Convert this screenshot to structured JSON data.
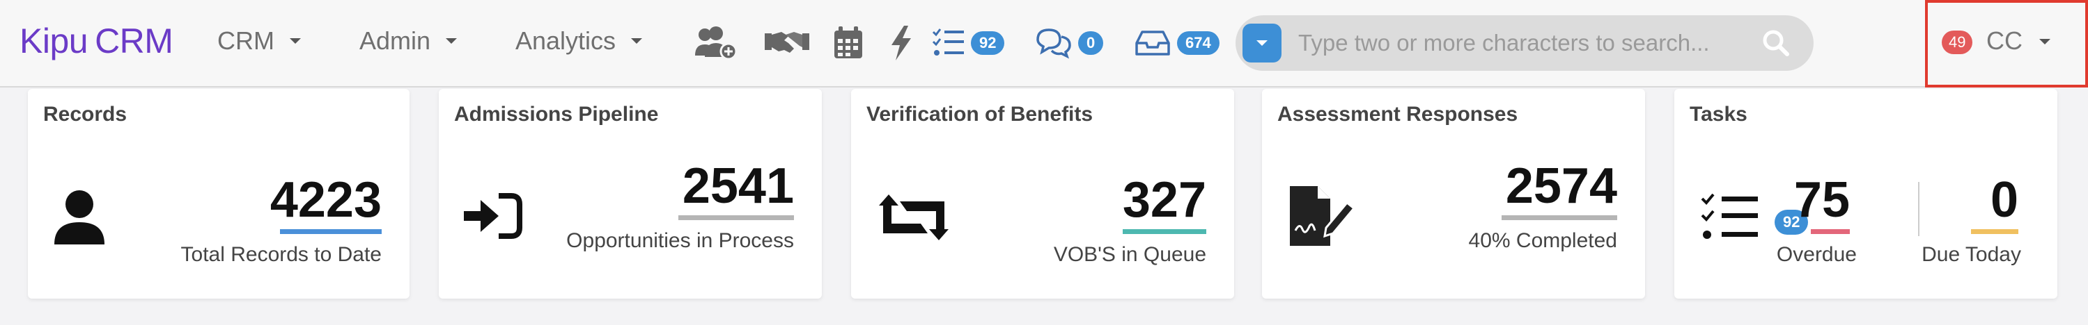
{
  "brand": {
    "part1": "Kipu",
    "part2": "CRM"
  },
  "nav": {
    "crm": "CRM",
    "admin": "Admin",
    "analytics": "Analytics"
  },
  "icons": {
    "tasks_count": "92",
    "messages_count": "0",
    "inbox_count": "674"
  },
  "search": {
    "placeholder": "Type two or more characters to search..."
  },
  "user": {
    "notification_count": "49",
    "initials": "CC"
  },
  "cards": {
    "records": {
      "title": "Records",
      "value": "4223",
      "label": "Total Records to Date",
      "bar_color": "#4a90d9"
    },
    "admissions": {
      "title": "Admissions Pipeline",
      "value": "2541",
      "label": "Opportunities in Process",
      "bar_color": "#b5b5b5"
    },
    "vob": {
      "title": "Verification of Benefits",
      "value": "327",
      "label": "VOB'S in Queue",
      "bar_color": "#4db8b0"
    },
    "assessment": {
      "title": "Assessment Responses",
      "value": "2574",
      "label": "40% Completed",
      "bar_color": "#b5b5b5"
    },
    "tasks": {
      "title": "Tasks",
      "badge": "92",
      "overdue_value": "75",
      "overdue_label": "Overdue",
      "overdue_color": "#e3677a",
      "today_value": "0",
      "today_label": "Due Today",
      "today_color": "#f0c060"
    }
  }
}
